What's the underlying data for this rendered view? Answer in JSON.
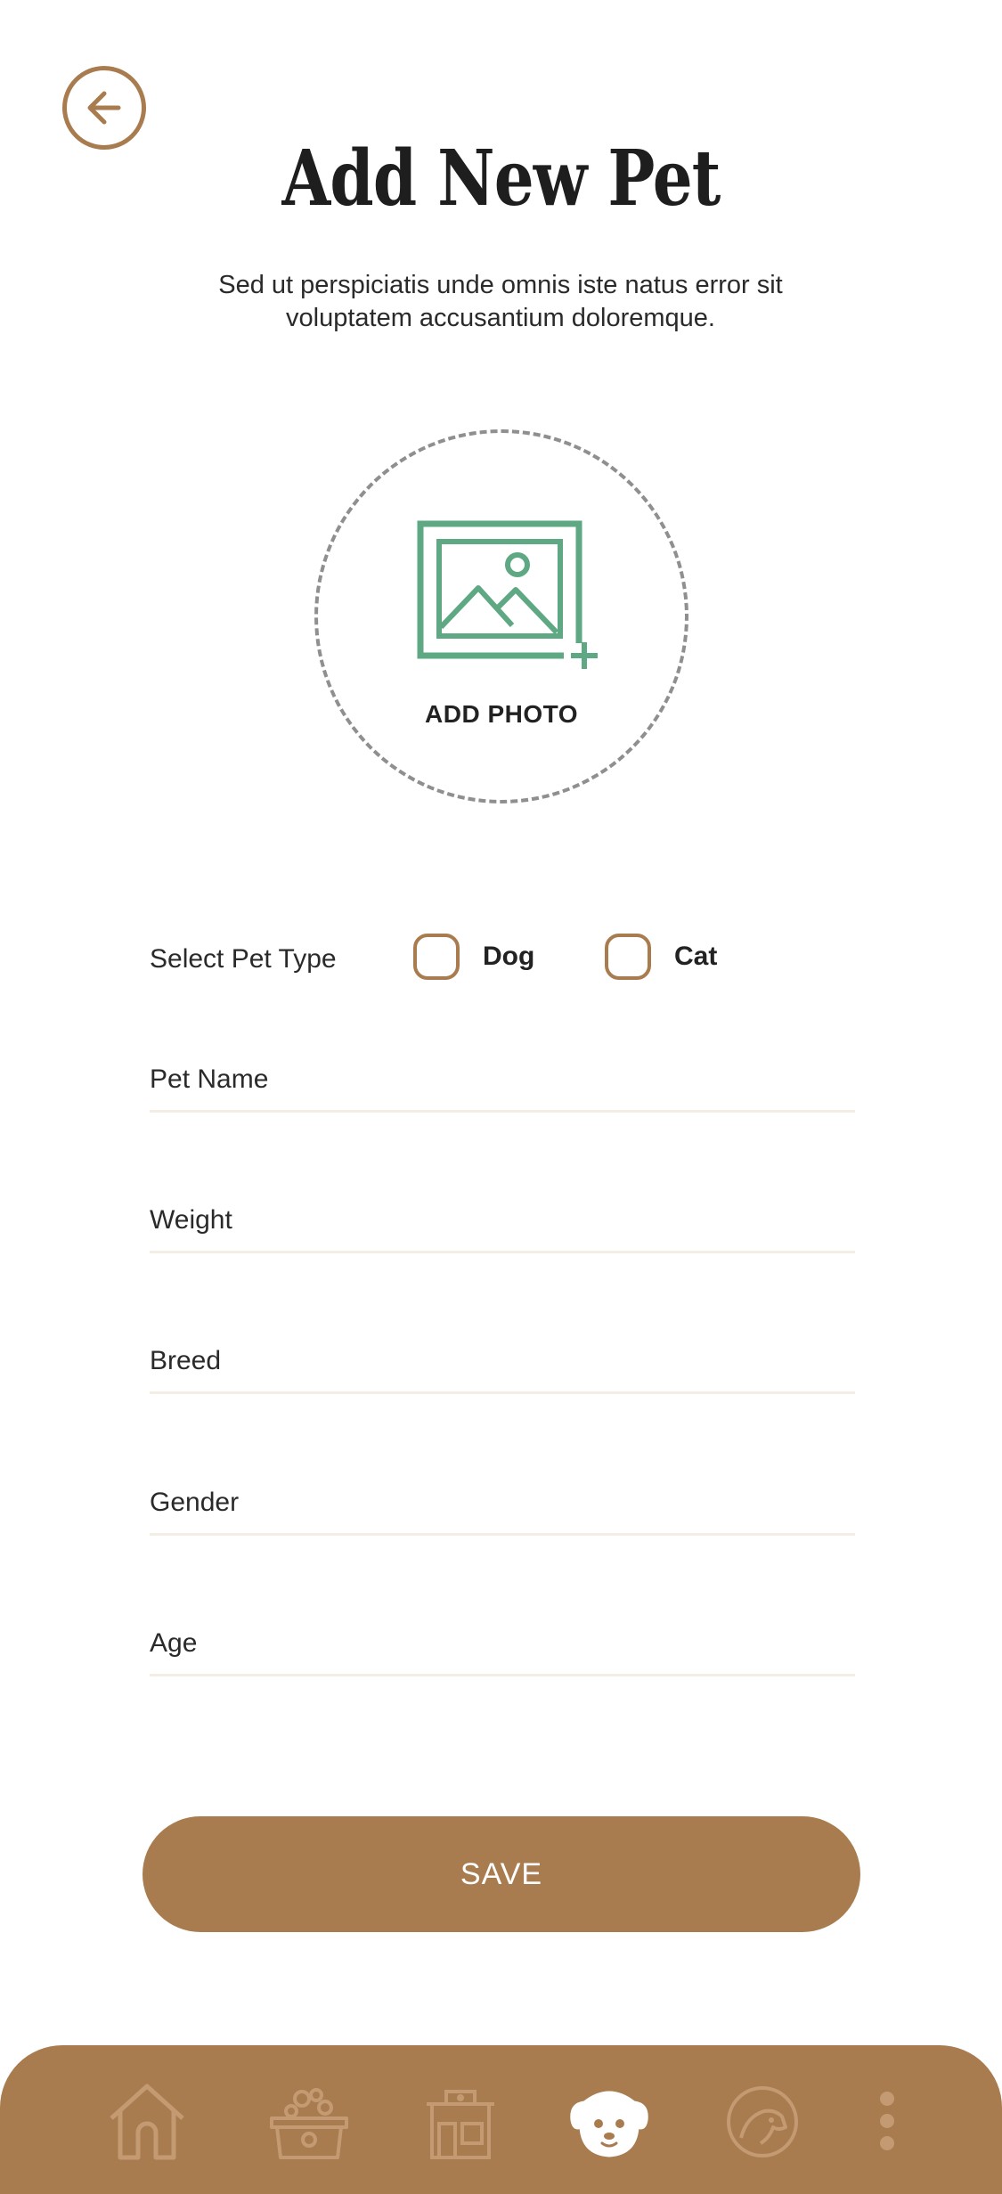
{
  "header": {
    "title": "Add New Pet",
    "subtitle": "Sed ut perspiciatis unde omnis iste natus error sit voluptatem accusantium doloremque.",
    "back_icon": "arrow-left-icon"
  },
  "photo": {
    "label": "ADD PHOTO",
    "icon": "add-image-icon"
  },
  "pet_type": {
    "label": "Select Pet Type",
    "options": [
      {
        "label": "Dog",
        "checked": false
      },
      {
        "label": "Cat",
        "checked": false
      }
    ]
  },
  "fields": {
    "pet_name": {
      "placeholder": "Pet Name",
      "value": ""
    },
    "weight": {
      "placeholder": "Weight",
      "value": ""
    },
    "breed": {
      "placeholder": "Breed",
      "value": ""
    },
    "gender": {
      "placeholder": "Gender",
      "value": ""
    },
    "age": {
      "placeholder": "Age",
      "value": ""
    }
  },
  "actions": {
    "save_label": "SAVE"
  },
  "tabbar": {
    "items": [
      {
        "icon": "home-icon",
        "active": false
      },
      {
        "icon": "pet-bath-icon",
        "active": false
      },
      {
        "icon": "pet-shop-icon",
        "active": false
      },
      {
        "icon": "dog-face-icon",
        "active": true
      },
      {
        "icon": "dog-profile-icon",
        "active": false
      },
      {
        "icon": "more-vertical-icon",
        "active": false
      }
    ]
  },
  "colors": {
    "accent": "#a97c50",
    "photo_icon": "#5ea883",
    "tab_inactive": "#c49a72",
    "tab_active": "#ffffff"
  }
}
